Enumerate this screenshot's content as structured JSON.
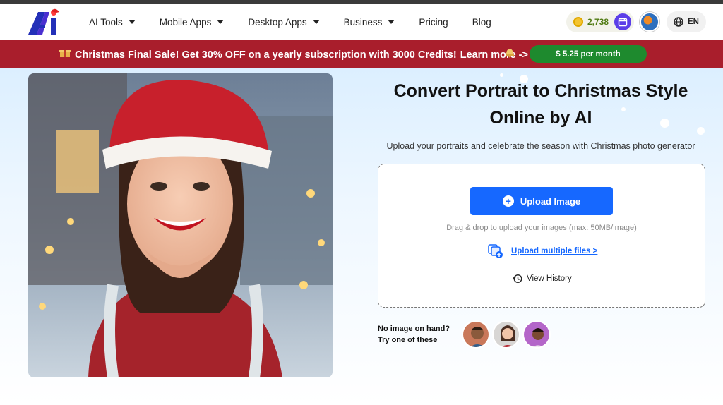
{
  "nav": {
    "items": [
      {
        "label": "AI Tools",
        "has_caret": true
      },
      {
        "label": "Mobile Apps",
        "has_caret": true
      },
      {
        "label": "Desktop Apps",
        "has_caret": true
      },
      {
        "label": "Business",
        "has_caret": true
      },
      {
        "label": "Pricing",
        "has_caret": false
      },
      {
        "label": "Blog",
        "has_caret": false
      }
    ],
    "credits": "2,738",
    "language": "EN"
  },
  "promo": {
    "text": "Christmas Final Sale! Get 30% OFF on a yearly subscription with 3000 Credits!",
    "link": "Learn more ->",
    "button": "$ 5.25 per month"
  },
  "hero": {
    "title_line1": "Convert Portrait to Christmas Style",
    "title_line2": "Online by AI",
    "subtitle": "Upload your portraits and celebrate the season with Christmas photo generator",
    "upload_button": "Upload Image",
    "drag_text": "Drag & drop to upload your images (max: 50MB/image)",
    "multiple_files": "Upload multiple files >",
    "view_history": "View History",
    "sample_line1": "No image on hand?",
    "sample_line2": "Try one of these"
  },
  "colors": {
    "accent": "#1668ff",
    "promo_bg": "#a91e2c",
    "promo_button": "#1e8a2e",
    "credits_text": "#4f7a12"
  }
}
